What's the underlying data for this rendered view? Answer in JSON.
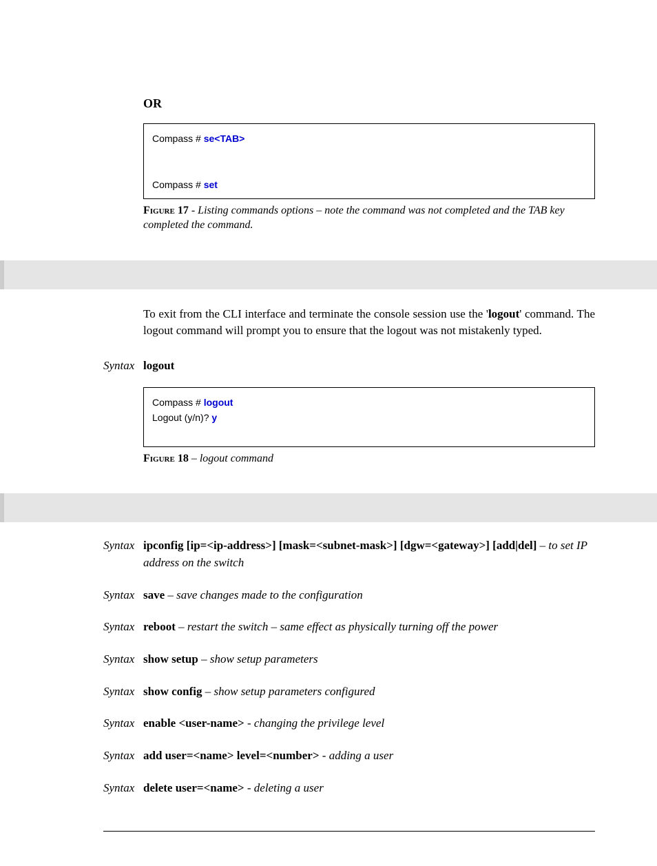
{
  "or_heading": "OR",
  "codebox1": {
    "l1_prompt": "Compass # ",
    "l1_cmd": "se<TAB>",
    "blank": " ",
    "l2_prompt": "Compass # ",
    "l2_cmd": "set"
  },
  "fig17": {
    "label": "Figure 17",
    "sep": "  -  ",
    "desc": "Listing commands options – note the command was not completed and the TAB key completed the command."
  },
  "exit_para_parts": {
    "p1": "To exit from the CLI interface and terminate the console session use the '",
    "kw": "logout",
    "p2": "' command. The logout command will prompt you to ensure that the logout was not mistakenly typed."
  },
  "syntax_logout": {
    "label": "Syntax",
    "cmd": "logout"
  },
  "codebox2": {
    "l1_prompt": "Compass # ",
    "l1_cmd": "logout",
    "l2_left": "Logout (y/n)? ",
    "l2_cmd": "y",
    "blank": " "
  },
  "fig18": {
    "label": "Figure 18",
    "sep": " – ",
    "desc": "logout command"
  },
  "syntax_list": [
    {
      "label": "Syntax",
      "cmd": "ipconfig [ip=<ip-address>] [mask=<subnet-mask>] [dgw=<gateway>] [add|del]",
      "sep": " – ",
      "desc": "to set IP address on the switch"
    },
    {
      "label": "Syntax",
      "cmd": "save",
      "sep": " – ",
      "desc": "save changes made to the configuration"
    },
    {
      "label": "Syntax",
      "cmd": "reboot",
      "sep": " – ",
      "desc": "restart the switch – same effect as physically turning off the power"
    },
    {
      "label": "Syntax",
      "cmd": "show setup",
      "sep": " – ",
      "desc": "show setup parameters"
    },
    {
      "label": "Syntax",
      "cmd": "show config",
      "sep": " – ",
      "desc": "show setup parameters configured"
    },
    {
      "label": "Syntax",
      "cmd": "enable <user-name>",
      "sep": " - ",
      "desc": "changing the privilege level"
    },
    {
      "label": "Syntax",
      "cmd": "add user=<name> level=<number>",
      "sep": " - ",
      "desc": "adding a user"
    },
    {
      "label": "Syntax",
      "cmd": "delete user=<name>",
      "sep": " - ",
      "desc": "deleting a user"
    }
  ]
}
